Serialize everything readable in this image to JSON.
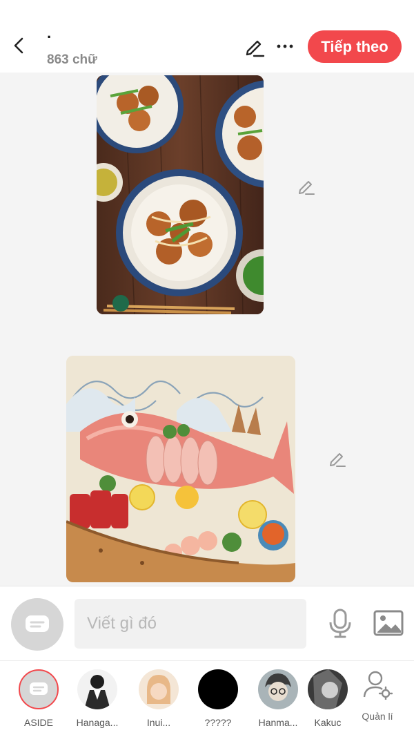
{
  "header": {
    "title": "·",
    "word_count": "863 chữ",
    "next_label": "Tiếp theo"
  },
  "composer": {
    "placeholder": "Viết gì đó"
  },
  "characters": [
    {
      "label": "ASIDE",
      "active": true
    },
    {
      "label": "Hanaga..."
    },
    {
      "label": "Inui..."
    },
    {
      "label": "?????"
    },
    {
      "label": "Hanma..."
    },
    {
      "label": "Kakuc"
    }
  ],
  "manage_label": "Quản lí",
  "colors": {
    "accent": "#f2484c",
    "content_bg": "#f4f4f4",
    "icon_gray": "#9a9a9a"
  }
}
